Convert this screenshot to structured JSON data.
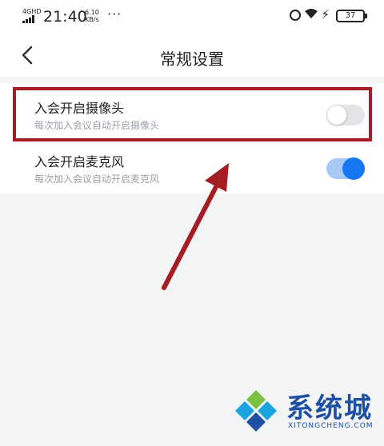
{
  "status_bar": {
    "network": "4GHD",
    "time": "21:40",
    "speed_value": "6.10",
    "speed_unit": "KB/s",
    "more_dots": "···",
    "battery_level": "37",
    "bolt": "⚡"
  },
  "header": {
    "title": "常规设置"
  },
  "settings": [
    {
      "title": "入会开启摄像头",
      "subtitle": "每次加入会议自动开启摄像头",
      "enabled": false
    },
    {
      "title": "入会开启麦克风",
      "subtitle": "每次加入会议自动开启麦克风",
      "enabled": true
    }
  ],
  "colors": {
    "accent": "#1677f2",
    "highlight": "#a51c22",
    "arrow": "#a51c22"
  },
  "watermark": {
    "text": "系统城",
    "url": "XITONGCHENG.COM"
  }
}
